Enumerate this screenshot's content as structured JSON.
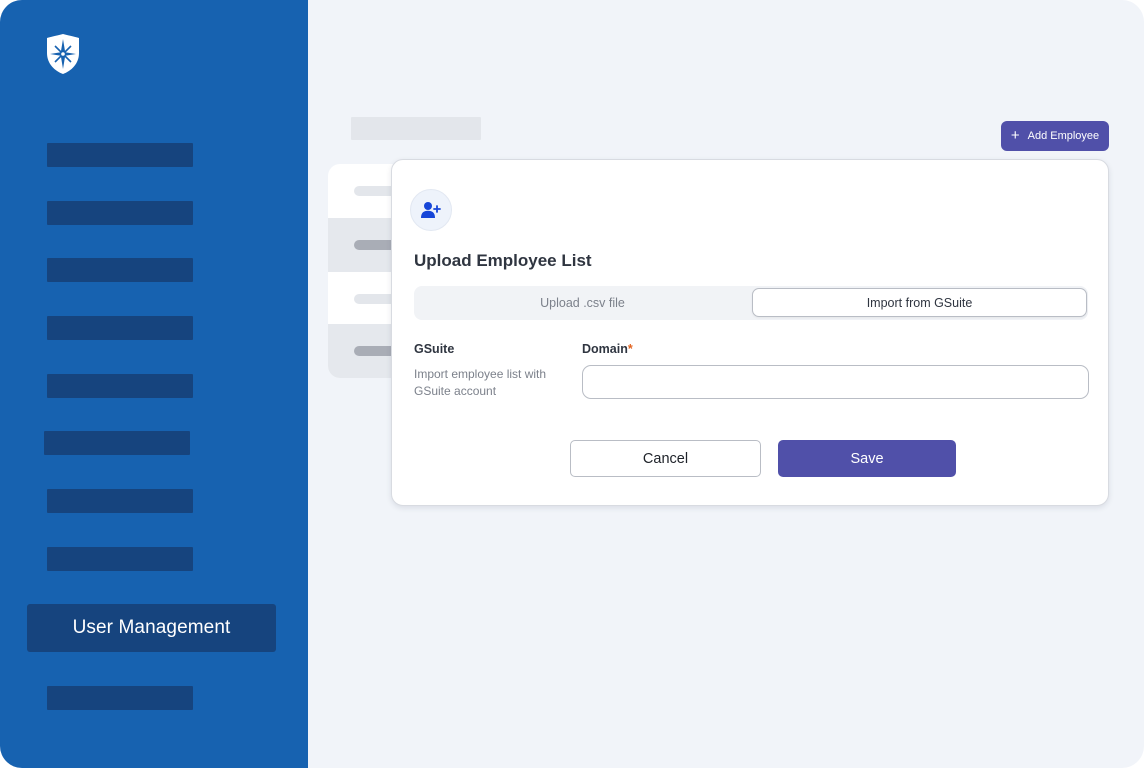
{
  "sidebar": {
    "logo_icon": "shield-compass-icon",
    "active_item": {
      "label": "User Management"
    },
    "placeholder_item_count": 9
  },
  "header": {
    "add_button": {
      "icon": "plus-icon",
      "label": "Add Employee"
    }
  },
  "modal": {
    "icon": "user-plus-icon",
    "title": "Upload Employee List",
    "tabs": [
      {
        "label": "Upload .csv file",
        "selected": false
      },
      {
        "label": "Import from GSuite",
        "selected": true
      }
    ],
    "section": {
      "label": "GSuite",
      "description": "Import employee list with GSuite account"
    },
    "domain_field": {
      "label": "Domain",
      "required_marker": "*",
      "value": "",
      "placeholder": ""
    },
    "actions": {
      "cancel_label": "Cancel",
      "save_label": "Save"
    }
  },
  "colors": {
    "sidebar_bg": "#1762b0",
    "sidebar_item": "#16447e",
    "accent": "#5050a9",
    "required": "#e2631f",
    "canvas_bg": "#f1f4f9"
  }
}
